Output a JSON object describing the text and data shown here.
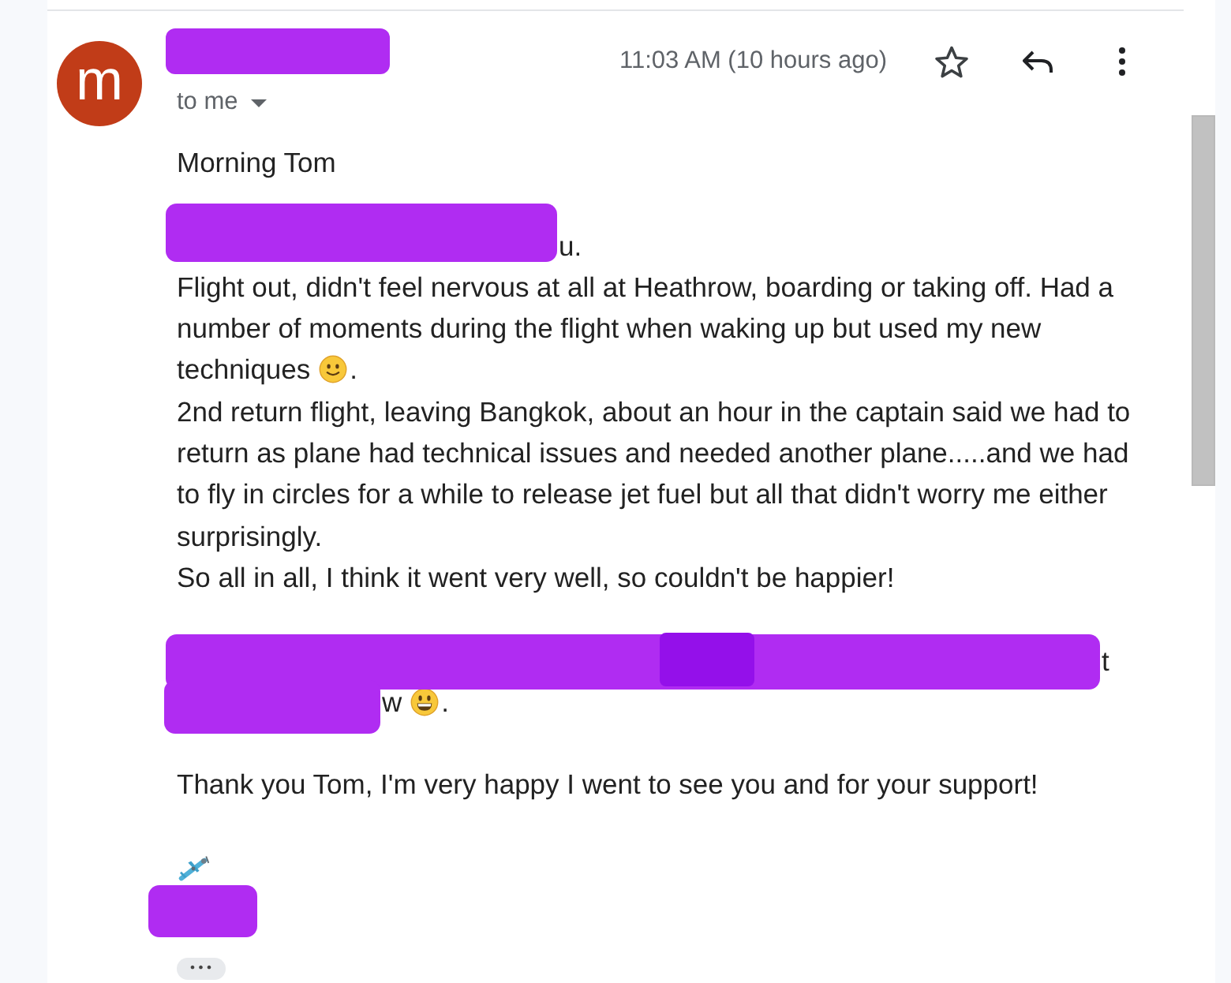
{
  "header": {
    "avatar_letter": "m",
    "sender_redacted": true,
    "recipient": "to me",
    "time": "11:03 AM (10 hours ago)",
    "starred": false
  },
  "body": [
    {
      "lines": [
        {
          "segments": [
            {
              "kind": "text",
              "text": "Morning Tom"
            }
          ]
        }
      ]
    },
    {
      "lines": [
        {
          "segments": [
            {
              "kind": "redaction"
            },
            {
              "kind": "text",
              "text": "u."
            }
          ]
        },
        {
          "segments": [
            {
              "kind": "text",
              "text": "Flight out, didn't feel nervous at all at Heathrow, boarding or taking off. Had a"
            }
          ]
        },
        {
          "segments": [
            {
              "kind": "text",
              "text": "number of moments during the flight when waking up but used my new"
            }
          ]
        },
        {
          "segments": [
            {
              "kind": "text",
              "text": "techniques"
            },
            {
              "kind": "smile"
            },
            {
              "kind": "text",
              "text": "."
            }
          ]
        },
        {
          "segments": [
            {
              "kind": "text",
              "text": "2nd return flight, leaving Bangkok, about an hour in the captain said we had to return as plane had technical issues and needed another plane.....and we had to fly in circles for a while to release jet fuel but all that didn't worry me either surprisingly."
            }
          ]
        },
        {
          "segments": [
            {
              "kind": "text",
              "text": "So all in all, I think it went very well, so couldn't be happier!"
            }
          ]
        }
      ]
    },
    {
      "lines": [
        {
          "segments": [
            {
              "kind": "redaction"
            },
            {
              "kind": "text",
              "text": "t"
            }
          ]
        },
        {
          "segments": [
            {
              "kind": "redaction"
            },
            {
              "kind": "text",
              "text": "w"
            },
            {
              "kind": "grin"
            },
            {
              "kind": "text",
              "text": "."
            }
          ]
        }
      ]
    },
    {
      "lines": [
        {
          "segments": [
            {
              "kind": "text",
              "text": "Thank you Tom, I'm very happy I went to see you and for your support!"
            }
          ]
        }
      ]
    },
    {
      "lines": [
        {
          "segments": [
            {
              "kind": "airplane"
            }
          ]
        },
        {
          "segments": [
            {
              "kind": "redaction"
            }
          ]
        }
      ]
    }
  ],
  "trimmed_content_button": "•••"
}
